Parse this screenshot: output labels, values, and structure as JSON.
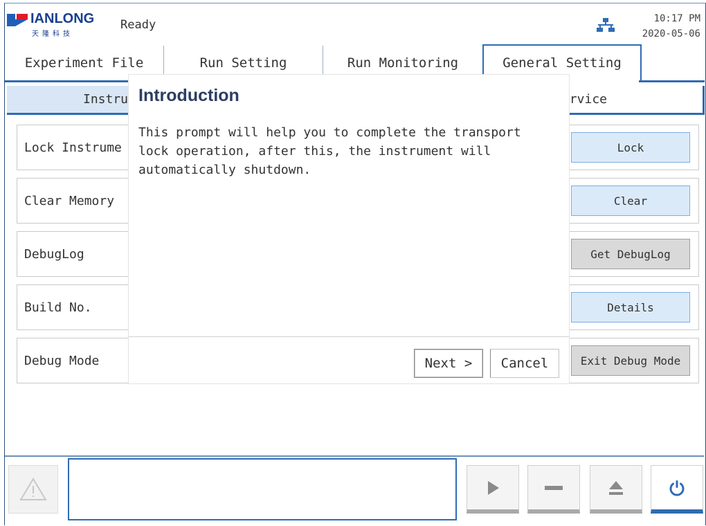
{
  "header": {
    "logo_brand": "IANLONG",
    "logo_cn": "天隆科技",
    "status": "Ready",
    "time": "10:17 PM",
    "date": "2020-05-06",
    "network_icon": "network-icon"
  },
  "tabs": [
    {
      "label": "Experiment File"
    },
    {
      "label": "Run Setting"
    },
    {
      "label": "Run Monitoring"
    },
    {
      "label": "General Setting"
    }
  ],
  "subtabs": {
    "left_visible": "Instru",
    "right_visible": "ervice"
  },
  "rows": [
    {
      "label": "Lock Instrume",
      "button": "Lock"
    },
    {
      "label": "Clear Memory",
      "button": "Clear"
    },
    {
      "label": "DebugLog",
      "button": "Get DebugLog"
    },
    {
      "label": "Build No.",
      "button": "Details"
    },
    {
      "label": "Debug Mode",
      "button": "Exit Debug Mode"
    }
  ],
  "dialog": {
    "title": "Introduction",
    "body": "This prompt will help you to complete the transport\nlock operation, after this, the instrument will\nautomatically shutdown.",
    "next_label": "Next >",
    "cancel_label": "Cancel"
  },
  "bottom": {
    "warning_icon": "warning-icon",
    "play_icon": "play-icon",
    "stop_icon": "stop-icon",
    "eject_icon": "eject-icon",
    "power_icon": "power-icon"
  },
  "colors": {
    "accent": "#2f6bb3",
    "button_fill": "#dbeaf9",
    "button_grey": "#d9d9d9",
    "title_color": "#2b3f63"
  }
}
